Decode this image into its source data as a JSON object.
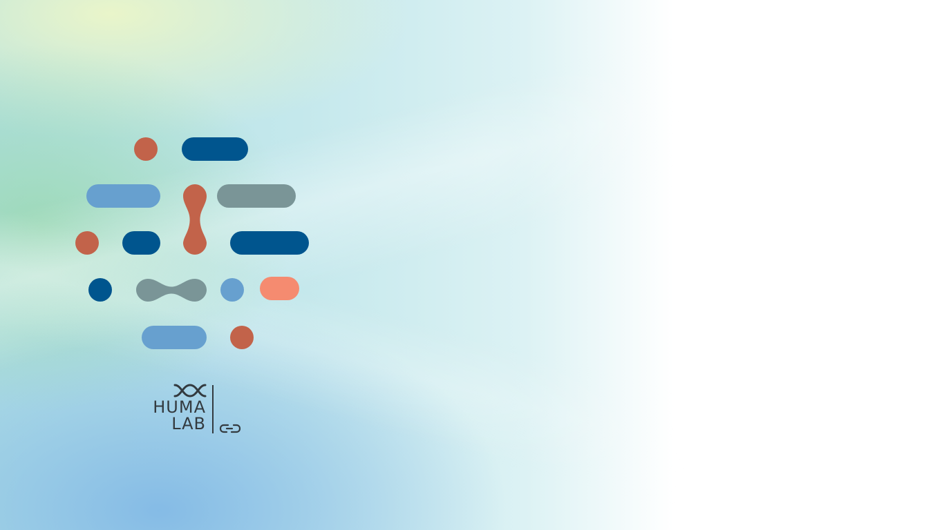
{
  "brand": {
    "logo_line1": "HUMA",
    "logo_line2": "LAB",
    "mark_icon": "double-helix-mark-icon",
    "sub_icon": "link-glyph-icon"
  },
  "colors": {
    "terracotta": "#c2634a",
    "navy": "#00558e",
    "sky": "#67a0cf",
    "slate": "#7a9597",
    "salmon": "#f58b70",
    "logo_text": "#333a3f"
  }
}
